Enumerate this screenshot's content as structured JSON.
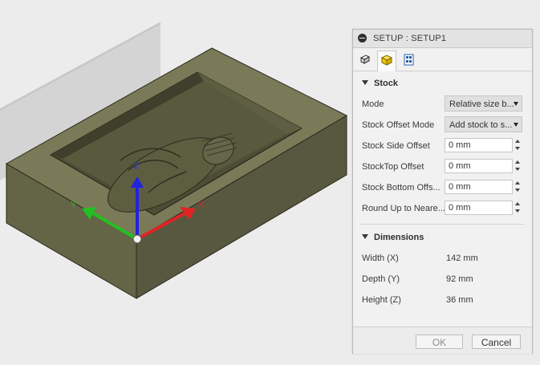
{
  "viewport": {
    "axes": {
      "x_label": "X",
      "y_label": "Y",
      "z_label": "Z"
    },
    "colors": {
      "stock": "#6b6b4a",
      "stock_dark": "#55553a",
      "x_axis": "#e02424",
      "y_axis": "#22c022",
      "z_axis": "#2222e0"
    }
  },
  "panel": {
    "title": "SETUP : SETUP1",
    "tabs": [
      {
        "icon": "setup-icon",
        "active": false
      },
      {
        "icon": "stock-box-icon",
        "active": true
      },
      {
        "icon": "post-process-icon",
        "active": false
      }
    ],
    "stock": {
      "heading": "Stock",
      "mode_label": "Mode",
      "mode_value": "Relative size b...",
      "offset_mode_label": "Stock Offset Mode",
      "offset_mode_value": "Add stock to s...",
      "side_offset_label": "Stock Side Offset",
      "side_offset_value": "0 mm",
      "top_offset_label": "StockTop Offset",
      "top_offset_value": "0 mm",
      "bottom_offset_label": "Stock Bottom Offs...",
      "bottom_offset_value": "0 mm",
      "round_label": "Round Up to Neare...",
      "round_value": "0 mm"
    },
    "dimensions": {
      "heading": "Dimensions",
      "width_label": "Width (X)",
      "width_value": "142 mm",
      "depth_label": "Depth (Y)",
      "depth_value": "92 mm",
      "height_label": "Height (Z)",
      "height_value": "36 mm"
    },
    "buttons": {
      "ok": "OK",
      "cancel": "Cancel"
    }
  }
}
